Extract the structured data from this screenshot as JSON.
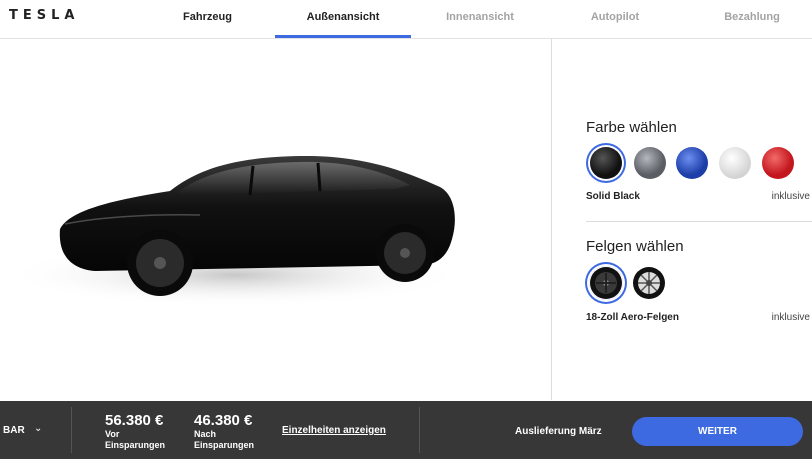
{
  "header": {
    "logo": "TESLA",
    "tabs": [
      {
        "label": "Fahrzeug",
        "state": "done"
      },
      {
        "label": "Außenansicht",
        "state": "active"
      },
      {
        "label": "Innenansicht",
        "state": "inactive"
      },
      {
        "label": "Autopilot",
        "state": "inactive"
      },
      {
        "label": "Bezahlung",
        "state": "inactive"
      }
    ]
  },
  "config": {
    "paint": {
      "heading": "Farbe wählen",
      "selected_name": "Solid Black",
      "selected_price": "inklusive",
      "swatches": [
        "#111111",
        "#5a5d63",
        "#1c3ea8",
        "#e6e6e6",
        "#c3161d"
      ]
    },
    "wheels": {
      "heading": "Felgen wählen",
      "selected_name": "18-Zoll Aero-Felgen",
      "selected_price": "inklusive",
      "options": [
        "aero-wheel-icon",
        "sport-wheel-icon"
      ]
    }
  },
  "footer": {
    "payment_mode": "BAR",
    "price_before": "56.380 €",
    "price_before_label_1": "Vor",
    "price_before_label_2": "Einsparungen",
    "price_after": "46.380 €",
    "price_after_label_1": "Nach",
    "price_after_label_2": "Einsparungen",
    "details_link": "Einzelheiten anzeigen",
    "delivery": "Auslieferung März",
    "next_button": "WEITER"
  },
  "colors": {
    "accent": "#3e6ae1",
    "footer_bg": "#373737"
  }
}
